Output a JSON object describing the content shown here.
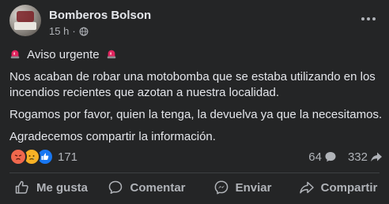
{
  "post": {
    "page_name": "Bomberos Bolson",
    "timestamp": "15 h",
    "separator": "·",
    "notice_title": "Aviso urgente",
    "paragraphs": {
      "robbery_line1": "Nos acaban de robar una motobomba que se estaba utilizando en los",
      "robbery_line2": "incendios recientes que azotan a nuestra localidad.",
      "plea": "Rogamos por favor, quien la tenga, la devuelva ya que la necesitamos.",
      "thanks": "Agradecemos compartir la información."
    },
    "icons": {
      "notice": "siren-emoji-icon",
      "privacy": "globe-icon",
      "more": "more-options-icon"
    }
  },
  "reactions": {
    "types": [
      "angry",
      "sad",
      "like"
    ],
    "count": "171",
    "comments_count": "64",
    "shares_count": "332"
  },
  "actions": {
    "like": "Me gusta",
    "comment": "Comentar",
    "send": "Enviar",
    "share": "Compartir"
  },
  "colors": {
    "background": "#242526",
    "text": "#e4e6eb",
    "secondary_text": "#b0b3b8",
    "divider": "#3e4042",
    "like_blue": "#1877f2",
    "angry_orange": "#f0684d",
    "sad_yellow": "#f7b125"
  }
}
